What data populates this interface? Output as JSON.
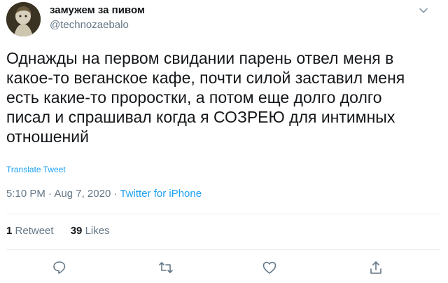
{
  "author": {
    "display_name": "замужем за пивом",
    "handle": "@technozaebalo"
  },
  "tweet": {
    "lines": [
      "Однажды на первом свидании парень отвел меня в",
      "какое-то веганское кафе, почти силой заставил меня",
      "есть какие-то проростки, а потом еще долго долго",
      "писал и спрашивал когда я СОЗРЕЮ для интимных",
      "отношений"
    ],
    "translate_label": "Translate Tweet",
    "time": "5:10 PM",
    "separator": " · ",
    "date": "Aug 7, 2020",
    "source": "Twitter for iPhone"
  },
  "stats": {
    "retweets_count": "1",
    "retweets_label": "Retweet",
    "likes_count": "39",
    "likes_label": "Likes"
  },
  "colors": {
    "accent": "#1da1f2",
    "secondary_text": "#657786",
    "primary_text": "#14171a",
    "divider": "#e6ecf0"
  },
  "icons": {
    "more": "chevron-down-icon",
    "reply": "reply-icon",
    "retweet": "retweet-icon",
    "like": "heart-icon",
    "share": "share-icon"
  }
}
